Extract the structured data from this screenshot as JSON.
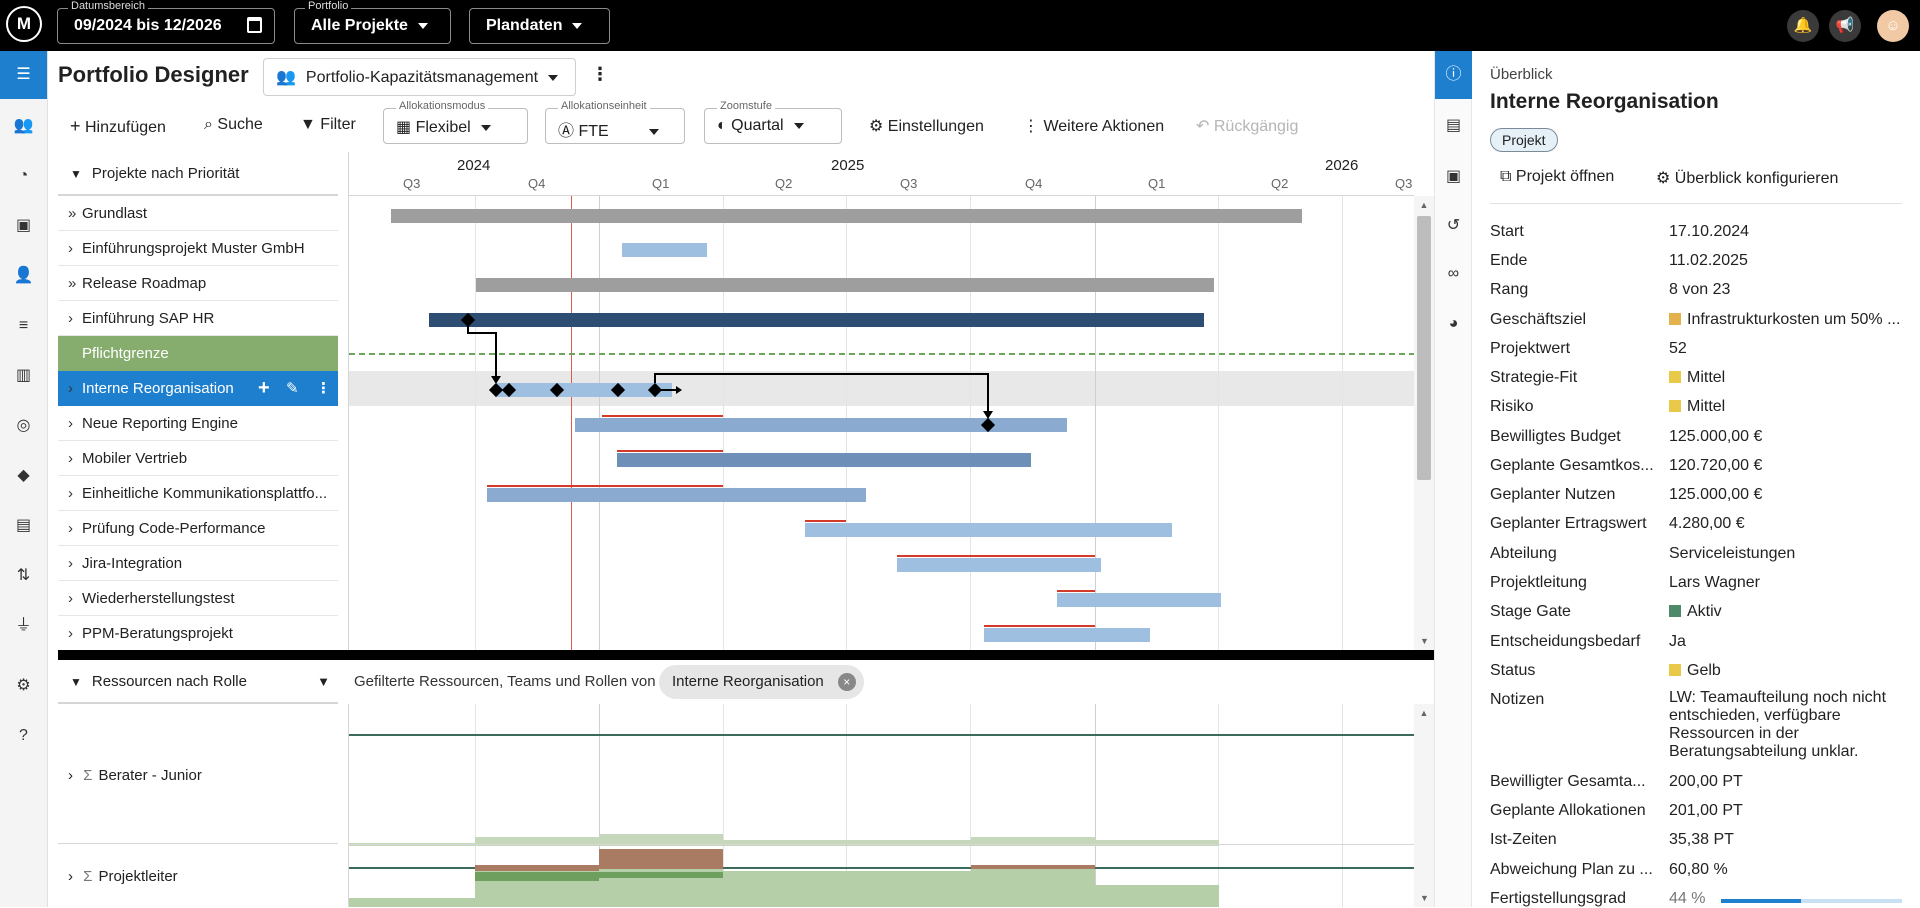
{
  "topbar": {
    "date_caption": "Datumsbereich",
    "date_value": "09/2024 bis 12/2026",
    "portfolio_caption": "Portfolio",
    "portfolio_value": "Alle Projekte",
    "plan_value": "Plandaten"
  },
  "header": {
    "title": "Portfolio Designer",
    "view": "Portfolio-Kapazitätsmanagement"
  },
  "toolbar": {
    "add": "Hinzufügen",
    "search": "Suche",
    "filter": "Filter",
    "alloc_mode_caption": "Allokationsmodus",
    "alloc_mode": "Flexibel",
    "alloc_unit_caption": "Allokationseinheit",
    "alloc_unit": "FTE",
    "zoom_caption": "Zoomstufe",
    "zoom": "Quartal",
    "settings": "Einstellungen",
    "more": "Weitere Aktionen",
    "undo": "Rückgängig"
  },
  "timeline": {
    "years": [
      "2024",
      "2025",
      "2026"
    ],
    "quarters": [
      "Q3",
      "Q4",
      "Q1",
      "Q2",
      "Q3",
      "Q4",
      "Q1",
      "Q2",
      "Q3"
    ]
  },
  "projects": {
    "header": "Projekte nach Priorität",
    "rows": [
      "Grundlast",
      "Einführungsprojekt Muster GmbH",
      "Release Roadmap",
      "Einführung SAP HR",
      "Pflichtgrenze",
      "Interne Reorganisation",
      "Neue Reporting Engine",
      "Mobiler Vertrieb",
      "Einheitliche Kommunikationsplattfo...",
      "Prüfung Code-Performance",
      "Jira-Integration",
      "Wiederherstellungstest",
      "PPM-Beratungsprojekt"
    ]
  },
  "resources": {
    "header": "Ressourcen nach Rolle",
    "filter_text": "Gefilterte Ressourcen, Teams und Rollen von",
    "filter_chip": "Interne Reorganisation",
    "rows": [
      "Berater - Junior",
      "Projektleiter"
    ]
  },
  "overview": {
    "section": "Überblick",
    "title": "Interne Reorganisation",
    "badge": "Projekt",
    "open": "Projekt öffnen",
    "configure": "Überblick konfigurieren",
    "fields": [
      {
        "label": "Start",
        "value": "17.10.2024"
      },
      {
        "label": "Ende",
        "value": "11.02.2025"
      },
      {
        "label": "Rang",
        "value": "8 von 23"
      },
      {
        "label": "Geschäftsziel",
        "value": "Infrastrukturkosten um 50% ...",
        "color": "#e3b24d"
      },
      {
        "label": "Projektwert",
        "value": "52"
      },
      {
        "label": "Strategie-Fit",
        "value": "Mittel",
        "color": "#e8c94a"
      },
      {
        "label": "Risiko",
        "value": "Mittel",
        "color": "#e8c94a"
      },
      {
        "label": "Bewilligtes Budget",
        "value": "125.000,00 €"
      },
      {
        "label": "Geplante Gesamtkos...",
        "value": "120.720,00 €"
      },
      {
        "label": "Geplanter Nutzen",
        "value": "125.000,00 €"
      },
      {
        "label": "Geplanter Ertragswert",
        "value": "4.280,00 €"
      },
      {
        "label": "Abteilung",
        "value": "Serviceleistungen"
      },
      {
        "label": "Projektleitung",
        "value": "Lars Wagner"
      },
      {
        "label": "Stage Gate",
        "value": "Aktiv",
        "color": "#4e8a6a"
      },
      {
        "label": "Entscheidungsbedarf",
        "value": "Ja"
      },
      {
        "label": "Status",
        "value": "Gelb",
        "color": "#e8c94a"
      }
    ],
    "notes_label": "Notizen",
    "notes": "LW: Teamaufteilung noch nicht entschieden, verfügbare Ressourcen in der Beratungsabteilung unklar.",
    "fields2": [
      {
        "label": "Bewilligter Gesamta...",
        "value": "200,00 PT"
      },
      {
        "label": "Geplante Allokationen",
        "value": "201,00 PT"
      },
      {
        "label": "Ist-Zeiten",
        "value": "35,38 PT"
      },
      {
        "label": "Abweichung Plan zu ...",
        "value": "60,80 %"
      }
    ],
    "progress_label": "Fertigstellungsgrad",
    "progress_value": "44 %",
    "progress_fraction": 0.44
  }
}
